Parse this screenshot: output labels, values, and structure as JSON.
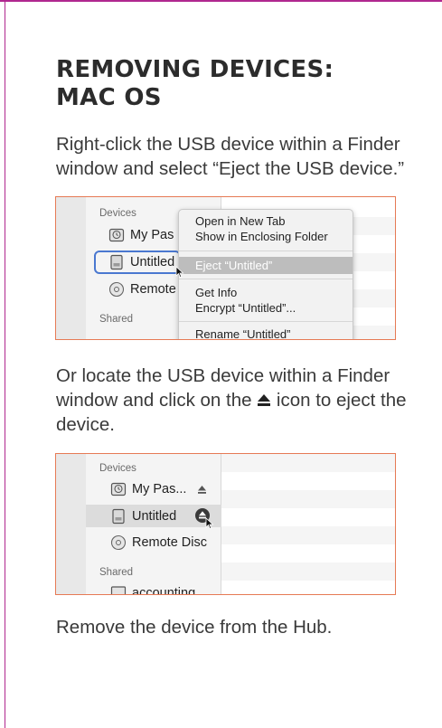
{
  "heading": {
    "line1": "REMOVING DEVICES:",
    "line2": "MAC OS"
  },
  "paragraph1": "Right-click the USB device within a Finder window and select “Eject the USB device.”",
  "paragraph2": {
    "before": "Or locate the USB device within a Finder window and click on the",
    "after": "icon to eject the device."
  },
  "paragraph3": "Remove the device from the Hub.",
  "screenshot1": {
    "sidebar": {
      "devices_label": "Devices",
      "items": [
        "My Pas",
        "Untitled",
        "Remote"
      ],
      "shared_label": "Shared"
    },
    "context_menu": {
      "items": [
        "Open in New Tab",
        "Show in Enclosing Folder",
        "Eject “Untitled”",
        "Get Info",
        "Encrypt “Untitled”...",
        "Rename “Untitled”"
      ],
      "highlighted_index": 2
    }
  },
  "screenshot2": {
    "sidebar": {
      "devices_label": "Devices",
      "items": [
        "My Pas...",
        "Untitled",
        "Remote Disc"
      ],
      "shared_label": "Shared",
      "partial_item": "accounting"
    }
  },
  "colors": {
    "frame": "#b0278f",
    "screenshot_border": "#e67a55",
    "selection_outline": "#4a78d0"
  }
}
